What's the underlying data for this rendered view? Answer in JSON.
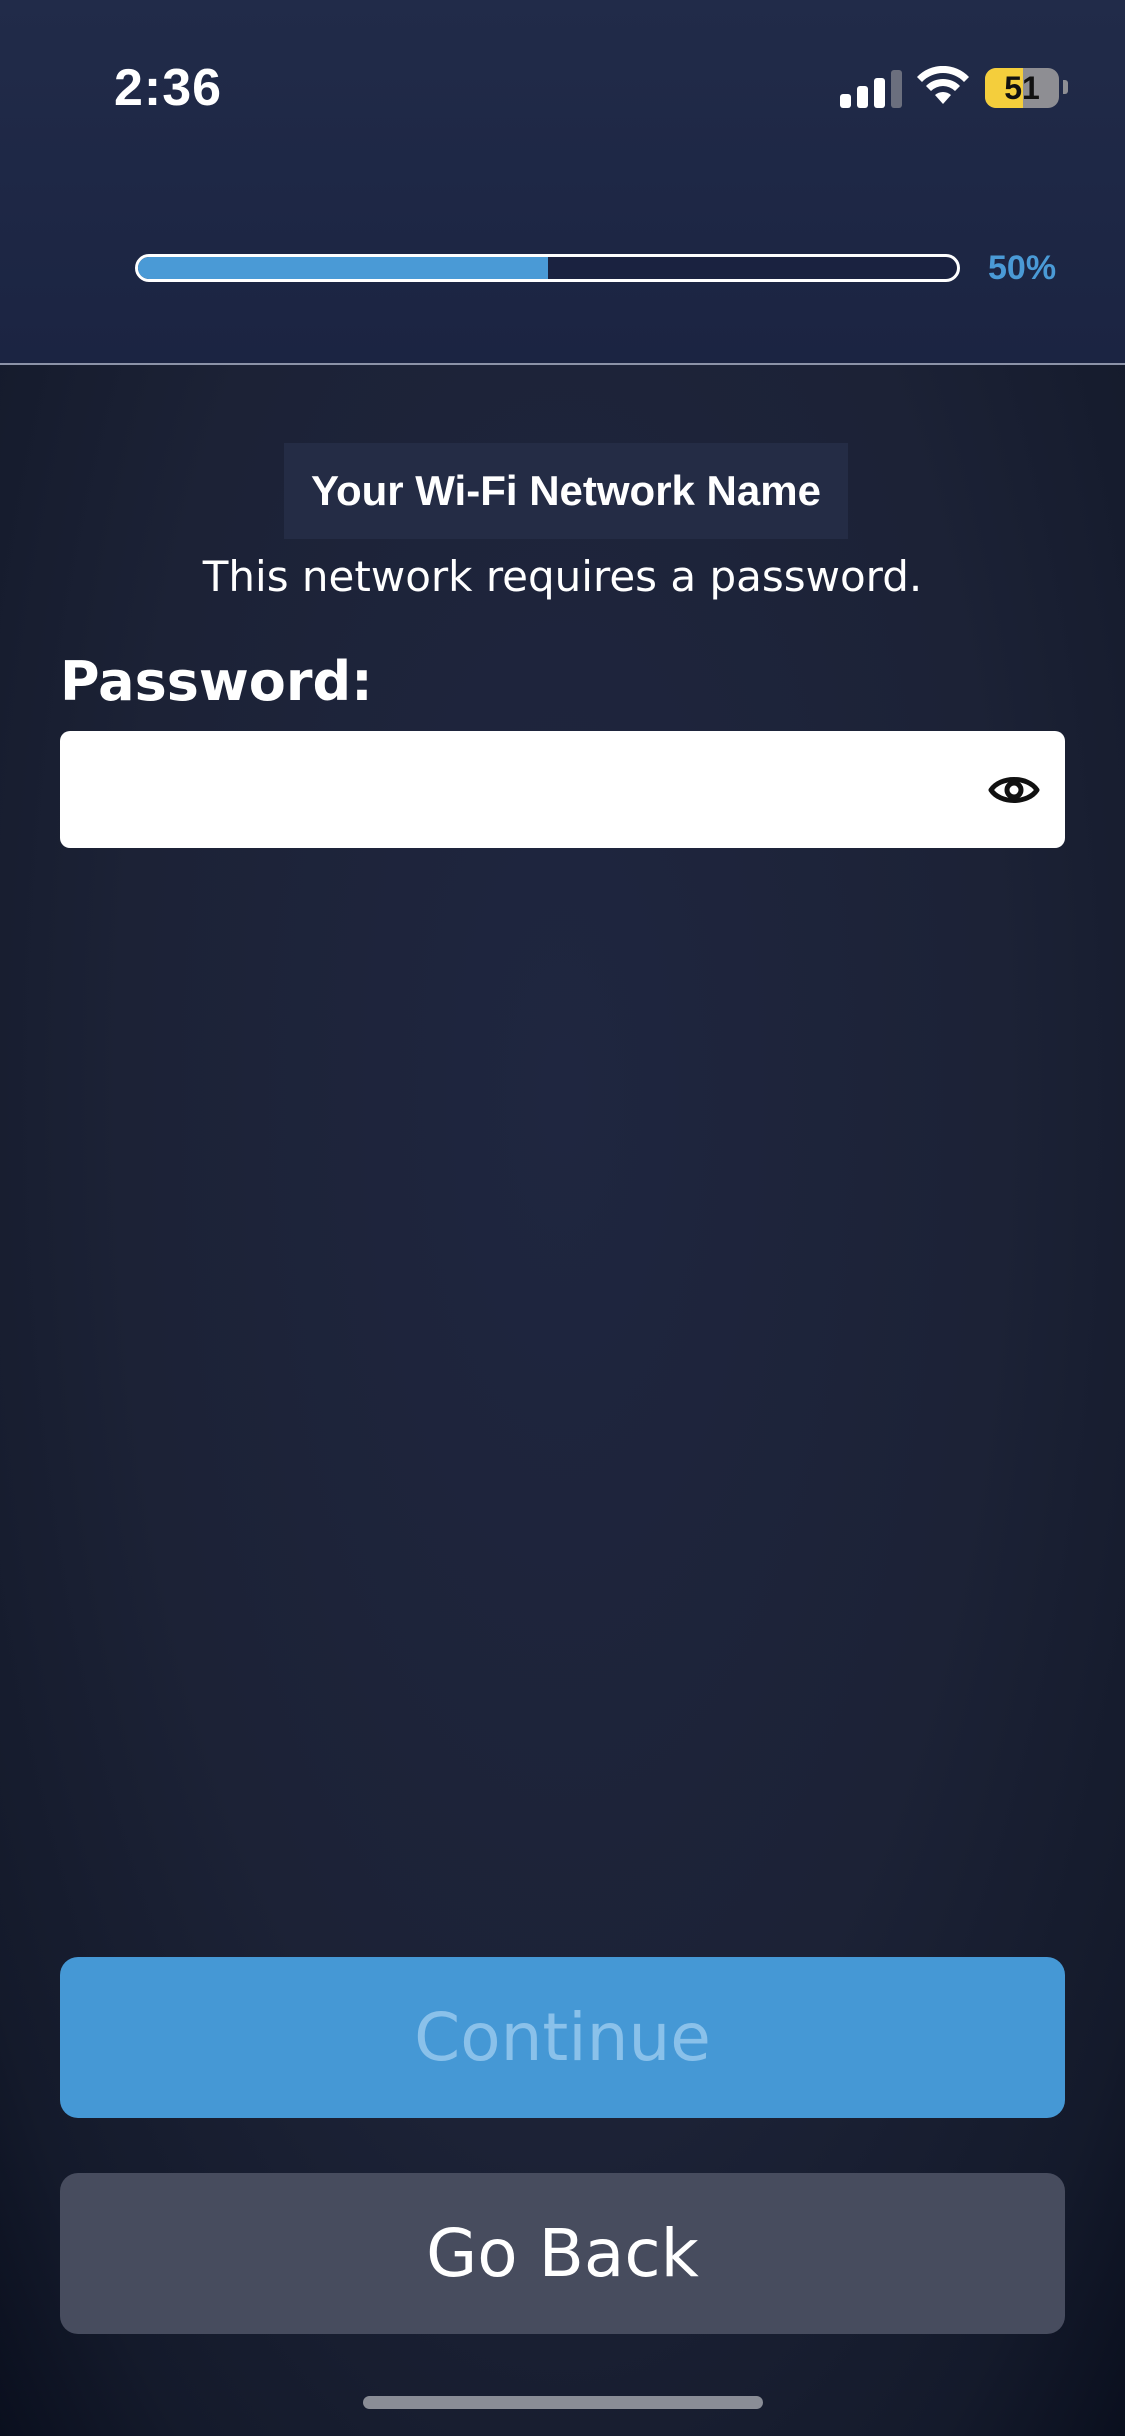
{
  "status_bar": {
    "time": "2:36",
    "battery": "51",
    "battery_level": 0.51,
    "battery_color": "#f4ce3c",
    "signal_icon": "cellular-signal-icon",
    "wifi_icon": "wifi-icon"
  },
  "progress": {
    "value": 0.5,
    "label": "50%",
    "color": "#4a9ad6"
  },
  "network": {
    "name": "Your Wi-Fi Network Name",
    "description": "This network requires a password."
  },
  "password": {
    "label": "Password:",
    "value": "",
    "toggle_icon": "eye-icon"
  },
  "buttons": {
    "continue_label": "Continue",
    "continue_color": "#4598d5",
    "back_label": "Go Back",
    "back_color": "#474c5e"
  }
}
